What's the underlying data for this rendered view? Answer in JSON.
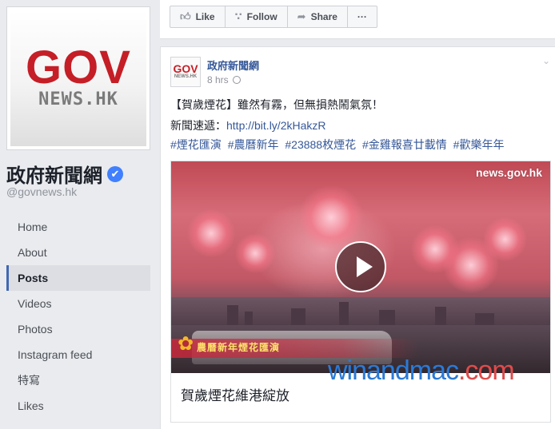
{
  "profile": {
    "logo_main": "GOV",
    "logo_sub": "NEWS.HK",
    "name": "政府新聞網",
    "verified_mark": "✔",
    "handle": "@govnews.hk"
  },
  "nav": {
    "items": [
      {
        "label": "Home",
        "active": false
      },
      {
        "label": "About",
        "active": false
      },
      {
        "label": "Posts",
        "active": true
      },
      {
        "label": "Videos",
        "active": false
      },
      {
        "label": "Photos",
        "active": false
      },
      {
        "label": "Instagram feed",
        "active": false
      },
      {
        "label": "特寫",
        "active": false
      },
      {
        "label": "Likes",
        "active": false
      }
    ]
  },
  "actions": {
    "like": "Like",
    "follow": "Follow",
    "share": "Share",
    "more": "···"
  },
  "post": {
    "avatar_main": "GOV",
    "avatar_sub": "NEWS.HK",
    "author": "政府新聞網",
    "time": "8 hrs",
    "text_line1": "【賀歲煙花】雖然有霧，但無損熱鬧氣氛！",
    "text_line2_prefix": "新聞速遞：",
    "link": "http://bit.ly/2kHakzR",
    "hashtags": [
      "#煙花匯演",
      "#農曆新年",
      "#23888枚煙花",
      "#金雞報喜廿載情",
      "#歡樂年年"
    ]
  },
  "video": {
    "watermark": "news.gov.hk",
    "caption_overlay": "農曆新年煙花匯演",
    "title": "賀歲煙花維港綻放"
  },
  "site_watermark": {
    "part1": "winandmac",
    "part2": ".com"
  },
  "colors": {
    "accent": "#4267b2",
    "link": "#365899",
    "brand_red": "#c51e26",
    "background": "#e9ebee"
  }
}
